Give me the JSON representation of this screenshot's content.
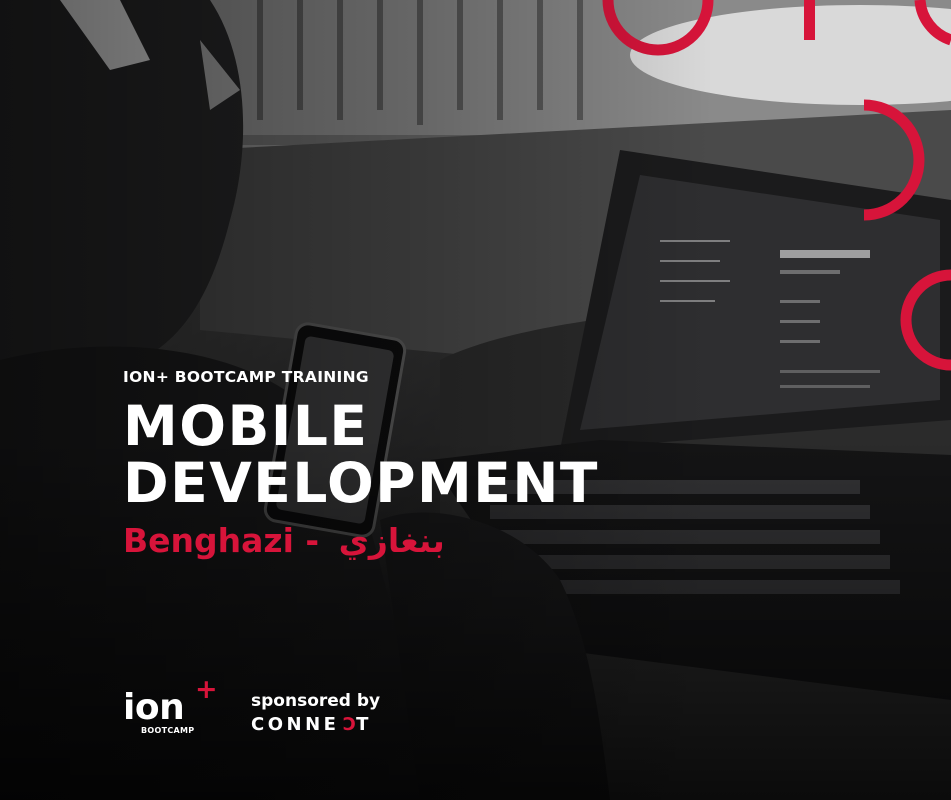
{
  "poster": {
    "kicker": "ION+ BOOTCAMP TRAINING",
    "title_lines": [
      "MOBILE",
      "DEVELOPMENT"
    ],
    "location_en": "Benghazi - ",
    "location_ar": "بنغازي"
  },
  "footer": {
    "ion_logo": {
      "word": "ion",
      "plus": "+",
      "sub": "BOOTCAMP"
    },
    "sponsor_label": "sponsored by",
    "sponsor_logo": {
      "main": "CONNE",
      "accent": "C",
      "end": "T"
    }
  },
  "colors": {
    "accent": "#d7143a",
    "text": "#ffffff",
    "dark_bg": "#0b0b0c"
  },
  "icons": [
    "red-ring-decoration-icon",
    "laptop-illustration",
    "smartphone-illustration",
    "person-silhouette-illustration"
  ]
}
